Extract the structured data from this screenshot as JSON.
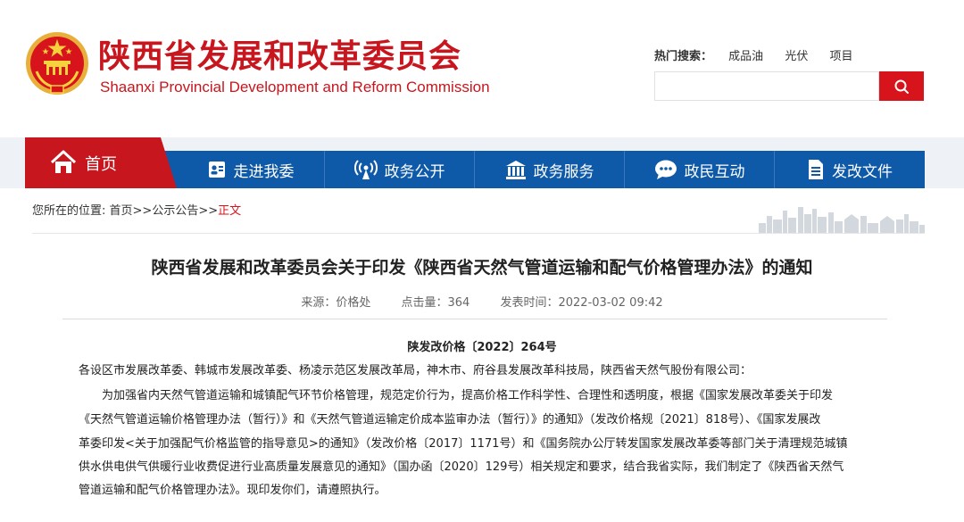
{
  "header": {
    "site_title": "陕西省发展和改革委员会",
    "site_subtitle": "Shaanxi Provincial Development and Reform Commission",
    "hot_search_label": "热门搜索：",
    "hot_search_items": [
      "成品油",
      "光伏",
      "项目"
    ],
    "search_placeholder": ""
  },
  "nav": {
    "home": "首页",
    "items": [
      "走进我委",
      "政务公开",
      "政务服务",
      "政民互动",
      "发改文件"
    ]
  },
  "breadcrumb": {
    "prefix": "您所在的位置:",
    "path": "首页>>公示公告>>",
    "current": "正文"
  },
  "article": {
    "title": "陕西省发展和改革委员会关于印发《陕西省天然气管道运输和配气价格管理办法》的通知",
    "source": "来源：价格处",
    "hits": "点击量：364",
    "published": "发表时间：2022-03-02 09:42",
    "doc_number": "陕发改价格〔2022〕264号",
    "recipients": "各设区市发展改革委、韩城市发展改革委、杨凌示范区发展改革局，神木市、府谷县发展改革科技局，陕西省天然气股份有限公司：",
    "body_lines": [
      "　　为加强省内天然气管道运输和城镇配气环节价格管理，规范定价行为，提高价格工作科学性、合理性和透明度，根据《国家发展改革委关于印发",
      "《天然气管道运输价格管理办法（暂行）》和《天然气管道运输定价成本监审办法（暂行）》的通知》（发改价格规〔2021〕818号）、《国家发展改",
      "革委印发<关于加强配气价格监管的指导意见>的通知》（发改价格〔2017〕1171号）和《国务院办公厅转发国家发展改革委等部门关于清理规范城镇",
      "供水供电供气供暖行业收费促进行业高质量发展意见的通知》（国办函〔2020〕129号）相关规定和要求，结合我省实际，我们制定了《陕西省天然气",
      "管道运输和配气价格管理办法》。现印发你们，请遵照执行。"
    ]
  },
  "colors": {
    "brand_red": "#c8161e",
    "nav_blue": "#0f5aa8"
  }
}
